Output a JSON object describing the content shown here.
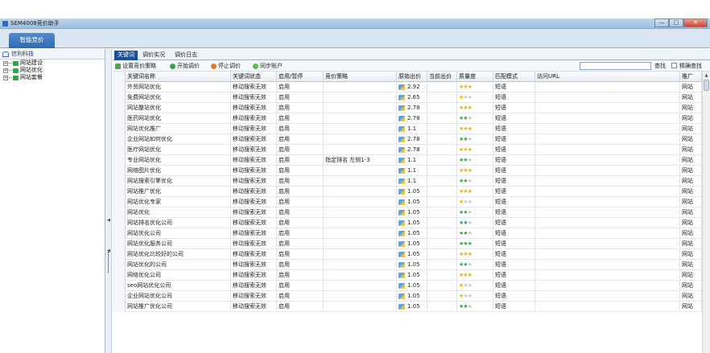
{
  "window": {
    "title": "SEM4008竞价助手",
    "controls": [
      "—",
      "□",
      "✕"
    ]
  },
  "ribbon": {
    "main_tab": "智能竞价"
  },
  "tree": {
    "root": "信利科技",
    "nodes": [
      "网站建设",
      "网站优化",
      "网站套餐"
    ]
  },
  "subtabs": [
    "关键词",
    "调价实况",
    "调价日志"
  ],
  "toolbar": {
    "buttons": [
      "设置竞价策略",
      "开始调价",
      "停止调价",
      "同步账户"
    ],
    "search_placeholder": "",
    "find_label": "查找",
    "exact_label": "精确查找"
  },
  "table": {
    "headers": [
      "关键词名称",
      "关键词状态",
      "启用/暂停",
      "竞价策略",
      "原始出价",
      "当前出价",
      "质量度",
      "匹配模式",
      "访问URL",
      "推广"
    ],
    "rows": [
      {
        "name": "外贸网站优化",
        "status": "移动搜索无效",
        "enabled": "启用",
        "strategy": "",
        "price": "2.92",
        "current": "",
        "quality": 3,
        "match": "短语",
        "url": "",
        "promo": "网站"
      },
      {
        "name": "免费网站优化",
        "status": "移动搜索无效",
        "enabled": "启用",
        "strategy": "",
        "price": "2.65",
        "current": "",
        "quality": 1,
        "match": "短语",
        "url": "",
        "promo": "网站"
      },
      {
        "name": "网站整站优化",
        "status": "移动搜索无效",
        "enabled": "启用",
        "strategy": "",
        "price": "2.78",
        "current": "",
        "quality": 3,
        "match": "短语",
        "url": "",
        "promo": "网站"
      },
      {
        "name": "医药网站优化",
        "status": "移动搜索无效",
        "enabled": "启用",
        "strategy": "",
        "price": "2.78",
        "current": "",
        "quality": 2,
        "match": "短语",
        "url": "",
        "promo": "网站"
      },
      {
        "name": "网站优化推广",
        "status": "移动搜索无效",
        "enabled": "启用",
        "strategy": "",
        "price": "1.1",
        "current": "",
        "quality": 3,
        "match": "短语",
        "url": "",
        "promo": "网站"
      },
      {
        "name": "企业网站如何优化",
        "status": "移动搜索无效",
        "enabled": "启用",
        "strategy": "",
        "price": "2.78",
        "current": "",
        "quality": 2,
        "match": "短语",
        "url": "",
        "promo": "网站"
      },
      {
        "name": "医疗网站优化",
        "status": "移动搜索无效",
        "enabled": "启用",
        "strategy": "",
        "price": "2.78",
        "current": "",
        "quality": 3,
        "match": "短语",
        "url": "",
        "promo": "网站"
      },
      {
        "name": "专业网站优化",
        "status": "移动搜索无效",
        "enabled": "启用",
        "strategy": "指定排名 左侧1-3",
        "price": "1.1",
        "current": "",
        "quality": 2,
        "match": "短语",
        "url": "",
        "promo": "网站"
      },
      {
        "name": "网络图片优化",
        "status": "移动搜索无效",
        "enabled": "启用",
        "strategy": "",
        "price": "1.1",
        "current": "",
        "quality": 3,
        "match": "短语",
        "url": "",
        "promo": "网站"
      },
      {
        "name": "网站搜索引擎优化",
        "status": "移动搜索无效",
        "enabled": "启用",
        "strategy": "",
        "price": "1.1",
        "current": "",
        "quality": 2,
        "match": "短语",
        "url": "",
        "promo": "网站"
      },
      {
        "name": "网站推广优化",
        "status": "移动搜索无效",
        "enabled": "启用",
        "strategy": "",
        "price": "1.05",
        "current": "",
        "quality": 3,
        "match": "短语",
        "url": "",
        "promo": "网站"
      },
      {
        "name": "网站优化专家",
        "status": "移动搜索无效",
        "enabled": "启用",
        "strategy": "",
        "price": "1.05",
        "current": "",
        "quality": 1,
        "match": "短语",
        "url": "",
        "promo": "网站"
      },
      {
        "name": "网站优化",
        "status": "移动搜索无效",
        "enabled": "启用",
        "strategy": "",
        "price": "1.05",
        "current": "",
        "quality": 2,
        "match": "短语",
        "url": "",
        "promo": "网站"
      },
      {
        "name": "网站排名优化公司",
        "status": "移动搜索无效",
        "enabled": "启用",
        "strategy": "",
        "price": "1.05",
        "current": "",
        "quality": 2,
        "match": "短语",
        "url": "",
        "promo": "网站"
      },
      {
        "name": "网站优化公司",
        "status": "移动搜索无效",
        "enabled": "启用",
        "strategy": "",
        "price": "1.05",
        "current": "",
        "quality": 2,
        "match": "短语",
        "url": "",
        "promo": "网站"
      },
      {
        "name": "网站优化服务公司",
        "status": "移动搜索无效",
        "enabled": "启用",
        "strategy": "",
        "price": "1.05",
        "current": "",
        "quality": 3,
        "match": "短语",
        "url": "",
        "promo": "网站"
      },
      {
        "name": "网站优化比较好的公司",
        "status": "移动搜索无效",
        "enabled": "启用",
        "strategy": "",
        "price": "1.05",
        "current": "",
        "quality": 3,
        "match": "短语",
        "url": "",
        "promo": "网站"
      },
      {
        "name": "网站优化的公司",
        "status": "移动搜索无效",
        "enabled": "启用",
        "strategy": "",
        "price": "1.05",
        "current": "",
        "quality": 2,
        "match": "短语",
        "url": "",
        "promo": "网站"
      },
      {
        "name": "网络优化公司",
        "status": "移动搜索无效",
        "enabled": "启用",
        "strategy": "",
        "price": "1.05",
        "current": "",
        "quality": 3,
        "match": "短语",
        "url": "",
        "promo": "网站"
      },
      {
        "name": "seo网站优化公司",
        "status": "移动搜索无效",
        "enabled": "启用",
        "strategy": "",
        "price": "1.05",
        "current": "",
        "quality": 1,
        "match": "短语",
        "url": "",
        "promo": "网站"
      },
      {
        "name": "企业网站优化公司",
        "status": "移动搜索无效",
        "enabled": "启用",
        "strategy": "",
        "price": "1.05",
        "current": "",
        "quality": 1,
        "match": "短语",
        "url": "",
        "promo": "网站"
      },
      {
        "name": "网站推广优化公司",
        "status": "移动搜索无效",
        "enabled": "启用",
        "strategy": "",
        "price": "1.05",
        "current": "",
        "quality": 2,
        "match": "短语",
        "url": "",
        "promo": "网站"
      }
    ]
  },
  "colors": {
    "accent": "#2f6bb5",
    "star_filled": "#f0b400",
    "star_green": "#3aa14a",
    "star_empty": "#c8c8c8"
  }
}
